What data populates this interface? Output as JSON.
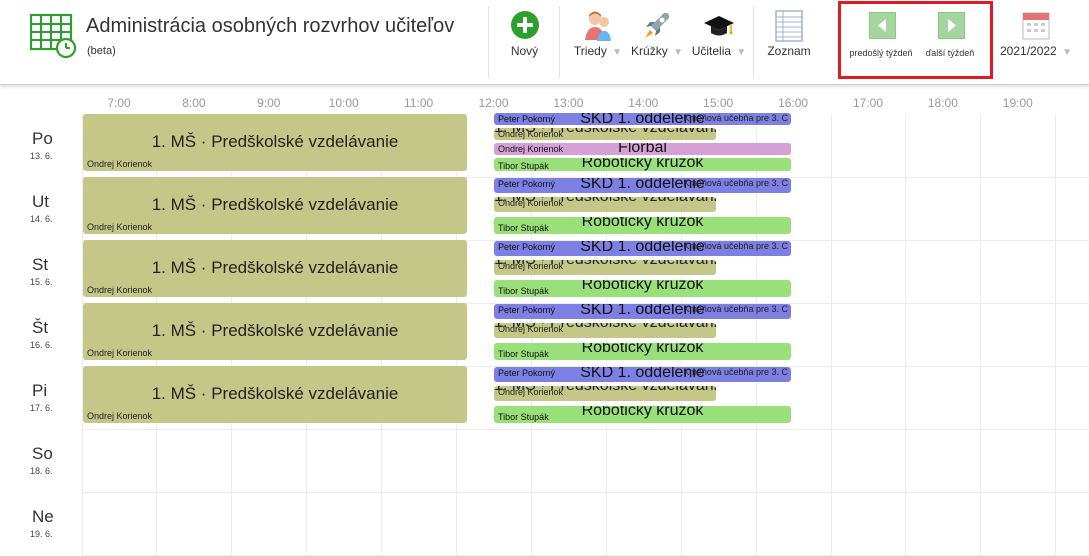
{
  "header": {
    "title": "Administrácia osobných rozvrhov učiteľov",
    "subtitle": "(beta)",
    "new_label": "Nový",
    "classes_label": "Triedy",
    "clubs_label": "Krúžky",
    "teachers_label": "Učitelia",
    "list_label": "Zoznam",
    "prev_week_label": "predošlý týždeň",
    "next_week_label": "ďalší týždeň",
    "school_year": "2021/2022",
    "caret": "▼",
    "accent_color": "#2ca02c",
    "highlight_color": "#e01b24"
  },
  "schedule": {
    "hours": [
      "7:00",
      "8:00",
      "9:00",
      "10:00",
      "11:00",
      "12:00",
      "13:00",
      "14:00",
      "15:00",
      "16:00",
      "17:00",
      "18:00",
      "19:00"
    ],
    "days": [
      {
        "name": "Po",
        "date": "13. 6."
      },
      {
        "name": "Ut",
        "date": "14. 6."
      },
      {
        "name": "St",
        "date": "15. 6."
      },
      {
        "name": "Št",
        "date": "16. 6."
      },
      {
        "name": "Pi",
        "date": "17. 6."
      },
      {
        "name": "So",
        "date": "18. 6."
      },
      {
        "name": "Ne",
        "date": "19. 6."
      }
    ],
    "ms_title": "1. MŠ · Predškolské vzdelávanie",
    "ms_title_short": "1. MŠ · Predškolské vzdelávanie",
    "ms_teacher": "Ondrej Korienok",
    "skd_title": "SKD 1. oddelenie",
    "skd_teacher": "Peter Pokorný",
    "skd_room": "Kmeňová učebňa pre 3. C",
    "rob_title": "Robotický krúžok",
    "rob_teacher": "Tibor Stupák",
    "flor_title": "Florbal",
    "flor_teacher": "Ondrej Korienok"
  }
}
